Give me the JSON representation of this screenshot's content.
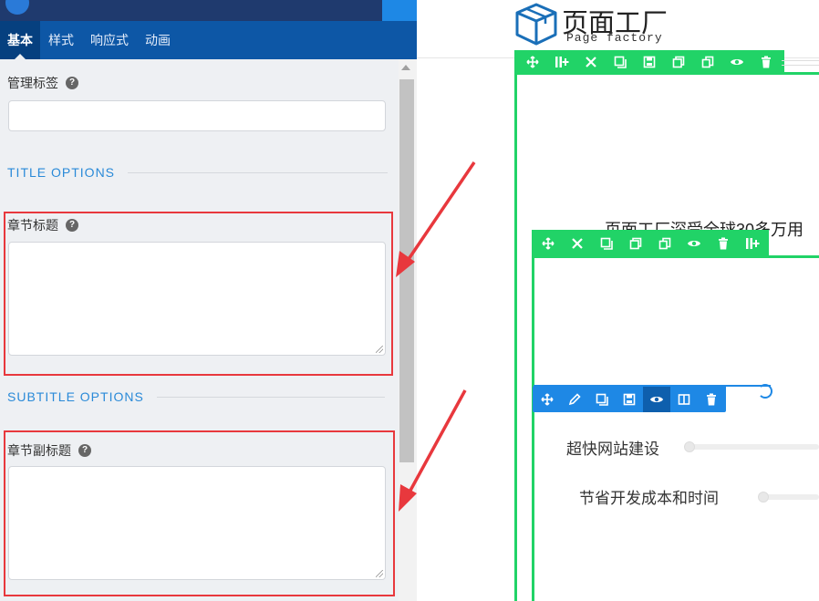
{
  "panel": {
    "tabs": [
      {
        "label": "基本",
        "active": true
      },
      {
        "label": "样式",
        "active": false
      },
      {
        "label": "响应式",
        "active": false
      },
      {
        "label": "动画",
        "active": false
      }
    ],
    "admin_label": "管理标签",
    "admin_value": "",
    "title_section": "TITLE OPTIONS",
    "chapter_title_label": "章节标题",
    "chapter_title_value": "",
    "subtitle_section": "SUBTITLE OPTIONS",
    "chapter_subtitle_label": "章节副标题",
    "chapter_subtitle_value": "",
    "help_glyph": "?"
  },
  "canvas": {
    "logo_title": "页面工厂",
    "logo_subtitle": "Page factory",
    "partial_heading": "页面工厂深受全球30多万用",
    "skills": [
      {
        "label": "超快网站建设",
        "level": 0
      },
      {
        "label": "节省开发成本和时间",
        "level": 0
      }
    ]
  },
  "toolbars": {
    "top_green": [
      "move-icon",
      "add-column-icon",
      "settings-icon",
      "copy-icon",
      "save-icon",
      "duplicate-icon",
      "paste-icon",
      "visibility-icon",
      "delete-icon"
    ],
    "inner_green": [
      "move-icon",
      "settings-icon",
      "copy-icon",
      "duplicate-icon",
      "paste-icon",
      "visibility-icon",
      "delete-icon",
      "add-column-icon"
    ],
    "blue": [
      "move-icon",
      "edit-icon",
      "copy-icon",
      "save-icon",
      "visibility-icon",
      "columns-icon",
      "delete-icon"
    ]
  },
  "colors": {
    "panel_header": "#1f3a6e",
    "tab_bar": "#0d57a6",
    "section_heading": "#2a8ad8",
    "highlight_box": "#e8383d",
    "arrow": "#e8383d",
    "builder_green": "#21d367",
    "builder_blue": "#1e88e5"
  }
}
